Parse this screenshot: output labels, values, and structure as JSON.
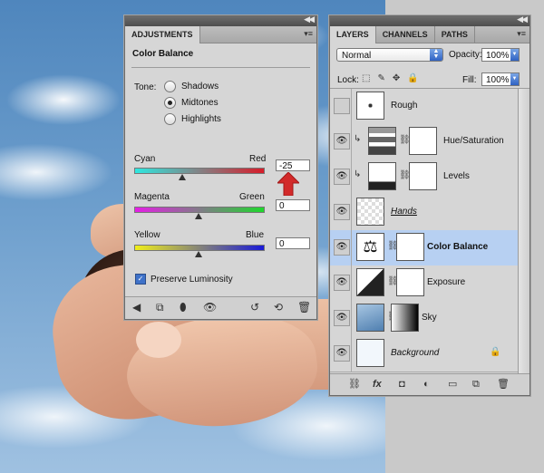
{
  "adjustments": {
    "tab": "ADJUSTMENTS",
    "title": "Color Balance",
    "tone_label": "Tone:",
    "tones": [
      {
        "label": "Shadows",
        "selected": false
      },
      {
        "label": "Midtones",
        "selected": true
      },
      {
        "label": "Highlights",
        "selected": false
      }
    ],
    "sliders": [
      {
        "left": "Cyan",
        "right": "Red",
        "value": "-25",
        "level": -25
      },
      {
        "left": "Magenta",
        "right": "Green",
        "value": "0",
        "level": 0
      },
      {
        "left": "Yellow",
        "right": "Blue",
        "value": "0",
        "level": 0
      }
    ],
    "preserve_luminosity": {
      "label": "Preserve Luminosity",
      "checked": true
    },
    "footer_icons": [
      "back-arrow-icon",
      "expand-view-icon",
      "clip-layer-icon",
      "eye-icon",
      "previous-state-icon",
      "reset-icon",
      "trash-icon"
    ]
  },
  "layers": {
    "tabs": [
      "LAYERS",
      "CHANNELS",
      "PATHS"
    ],
    "active_tab": "LAYERS",
    "blend_mode": "Normal",
    "opacity_label": "Opacity:",
    "opacity": "100%",
    "lock_label": "Lock:",
    "fill_label": "Fill:",
    "fill": "100%",
    "list": [
      {
        "name": "Rough",
        "visible": false,
        "selected": false
      },
      {
        "name": "Hue/Saturation",
        "visible": true,
        "selected": false
      },
      {
        "name": "Levels",
        "visible": true,
        "selected": false
      },
      {
        "name": "Hands",
        "visible": true,
        "selected": false
      },
      {
        "name": "Color Balance",
        "visible": true,
        "selected": true
      },
      {
        "name": "Exposure",
        "visible": true,
        "selected": false
      },
      {
        "name": "Sky",
        "visible": true,
        "selected": false
      },
      {
        "name": "Background",
        "visible": true,
        "selected": false
      }
    ],
    "footer_icons": [
      "link-layers-icon",
      "fx-icon",
      "add-mask-icon",
      "new-adjustment-icon",
      "new-group-icon",
      "new-layer-icon",
      "trash-icon"
    ]
  },
  "colors": {
    "selected_layer": "#b7d0f2",
    "arrow": "#d22a2a",
    "panel_bg": "#d6d6d6"
  }
}
